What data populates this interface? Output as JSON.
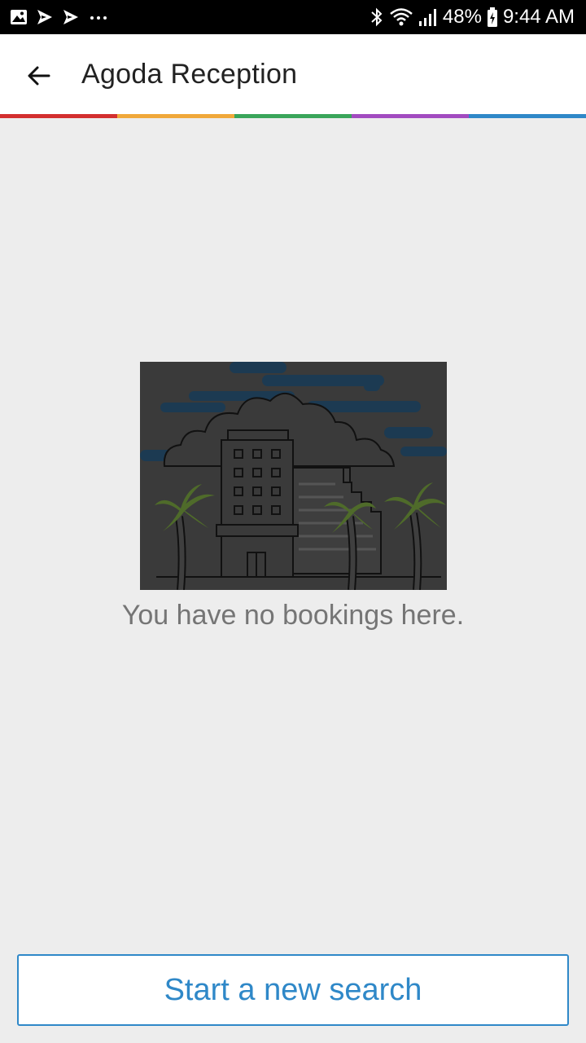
{
  "status_bar": {
    "icons_left": [
      "image-icon",
      "notification-icon",
      "notification-icon",
      "more-icon"
    ],
    "icons_right": [
      "bluetooth-icon",
      "wifi-icon",
      "signal-icon",
      "battery-icon"
    ],
    "battery": "48%",
    "time": "9:44 AM"
  },
  "toolbar": {
    "title": "Agoda Reception",
    "back_icon": "arrow-left-icon"
  },
  "colors": {
    "rainbow": [
      "#d32f2f",
      "#f0a83a",
      "#3aa55a",
      "#a24bc0",
      "#2f88c8"
    ],
    "accent": "#2f88c8"
  },
  "empty_state": {
    "illustration": "hotel-with-palm-trees",
    "message": "You have no bookings here."
  },
  "actions": {
    "search_label": "Start a new search"
  }
}
